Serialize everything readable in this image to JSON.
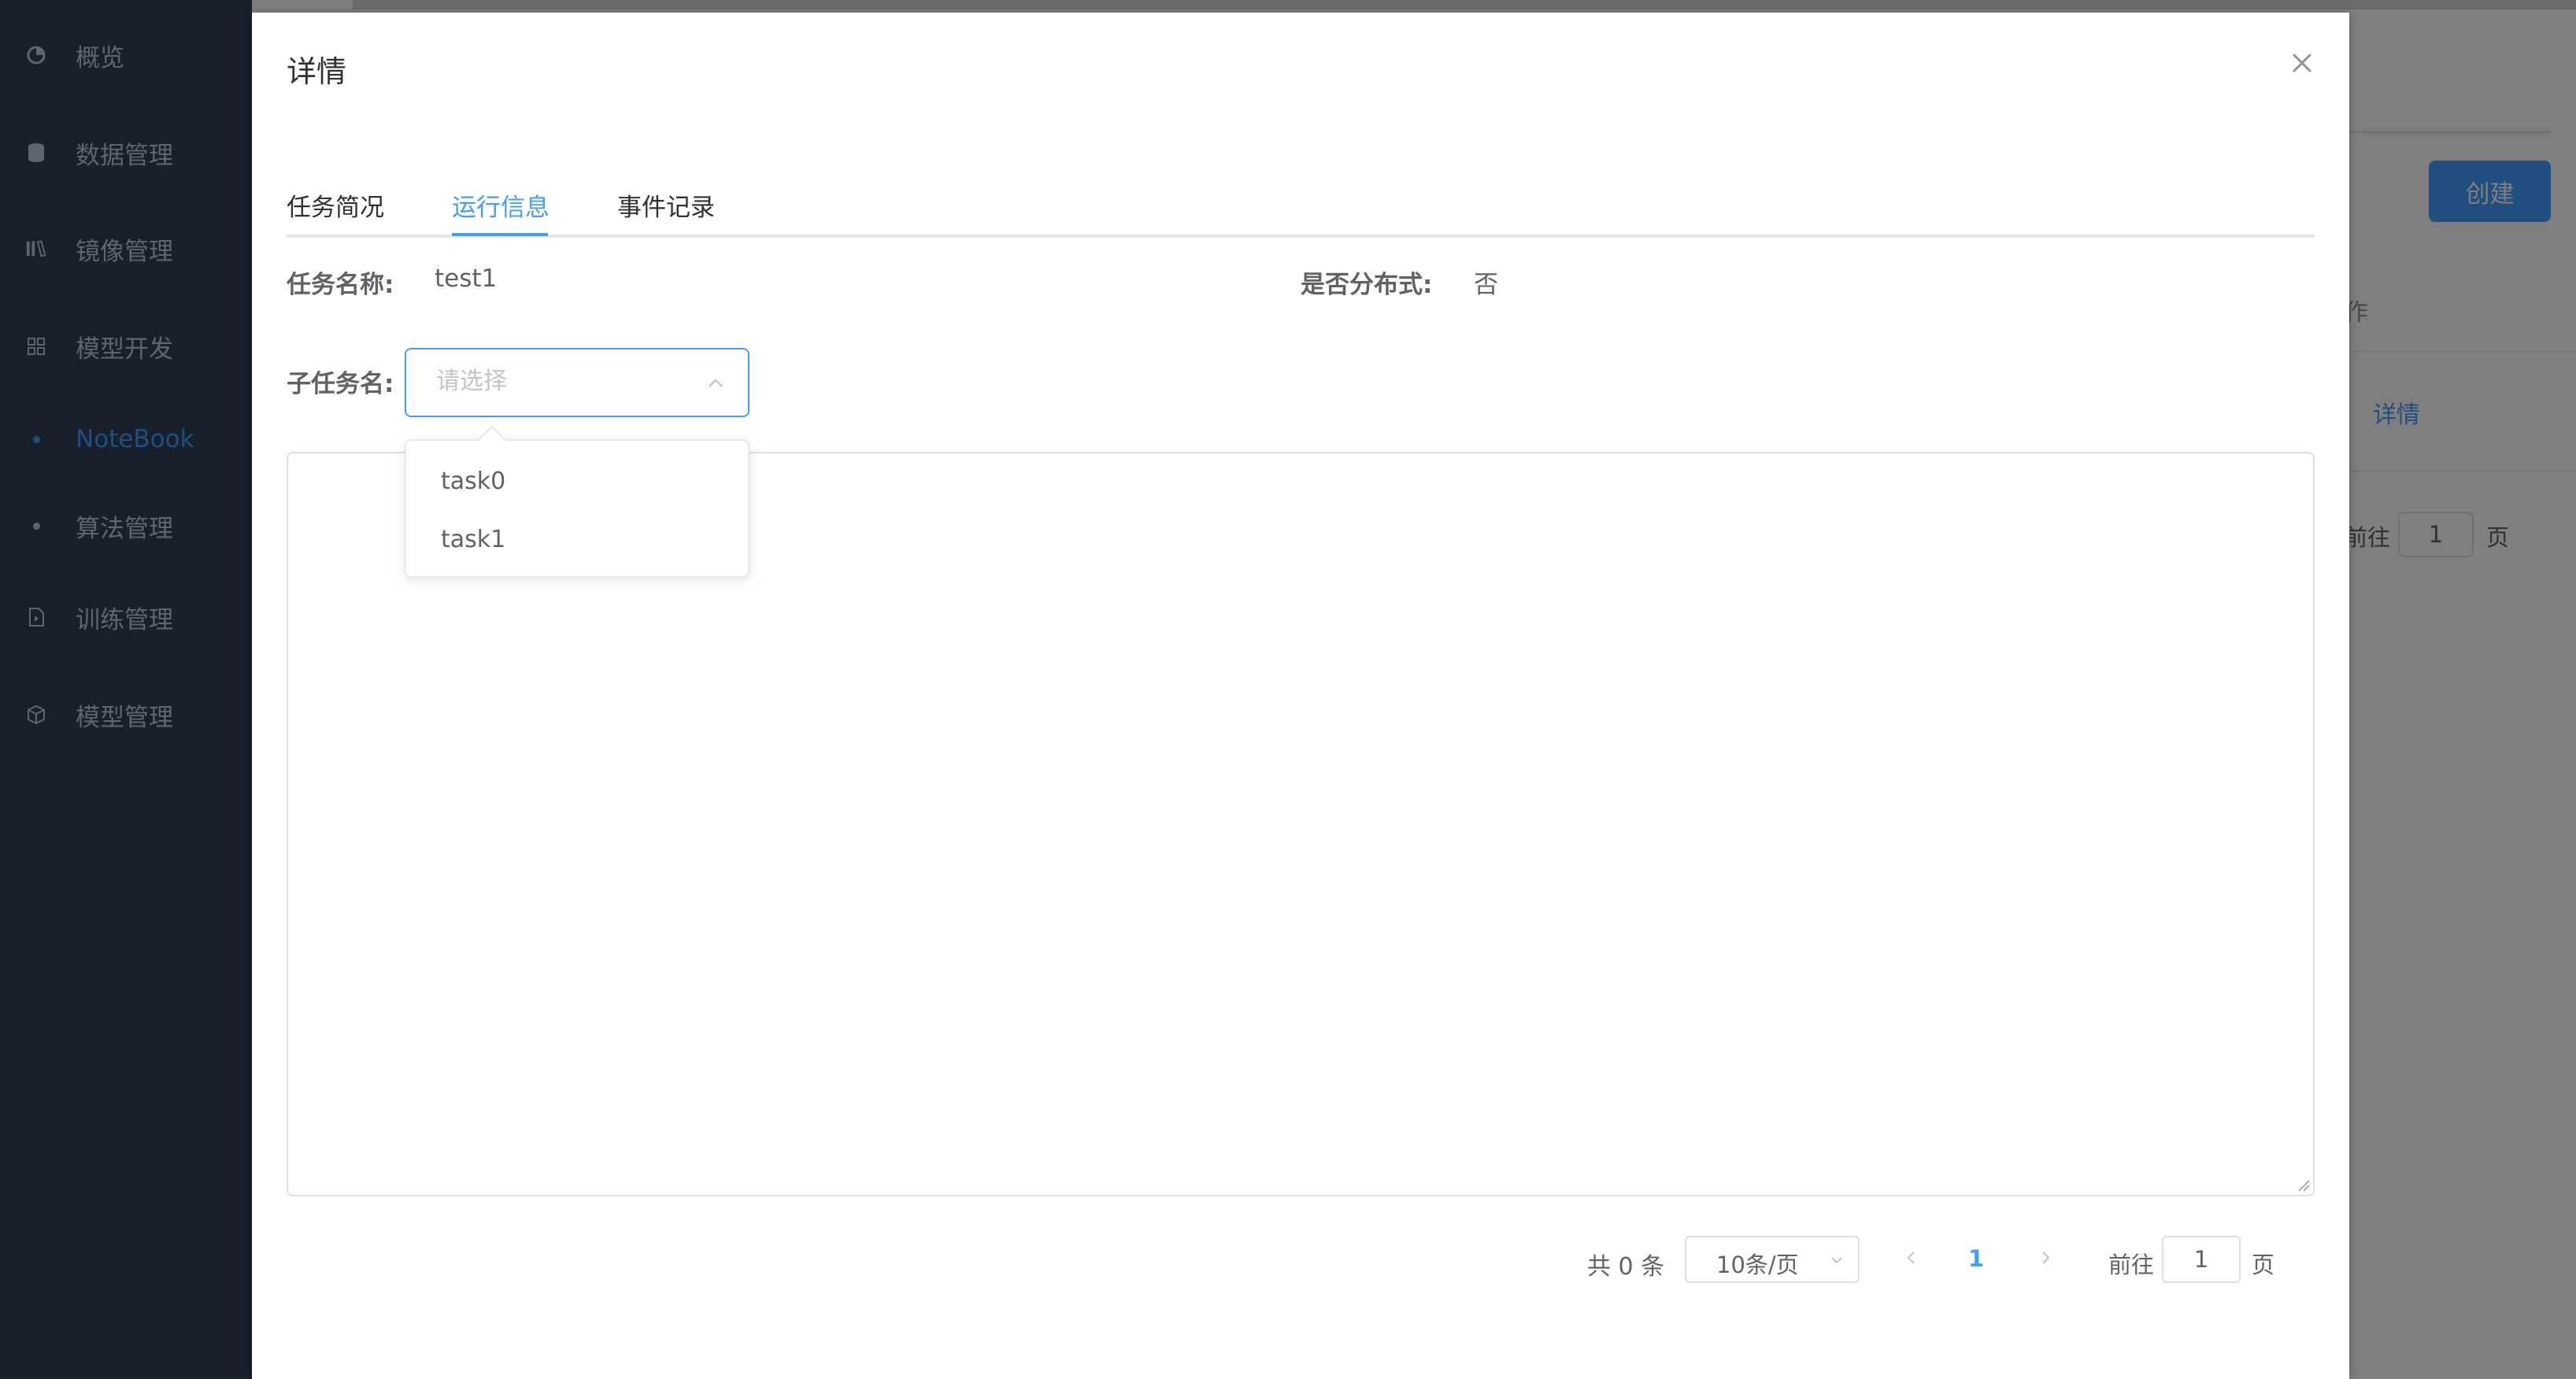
{
  "sidebar": {
    "items": [
      {
        "label": "概览",
        "icon": "pie-chart-icon"
      },
      {
        "label": "数据管理",
        "icon": "database-icon"
      },
      {
        "label": "镜像管理",
        "icon": "books-icon"
      },
      {
        "label": "模型开发",
        "icon": "grid-icon"
      },
      {
        "label": "NoteBook",
        "icon": "dot-icon",
        "active": true
      },
      {
        "label": "算法管理",
        "icon": "dot-icon"
      },
      {
        "label": "训练管理",
        "icon": "document-icon"
      },
      {
        "label": "模型管理",
        "icon": "cube-icon"
      }
    ]
  },
  "background": {
    "create_label": "创建",
    "column_header": "作",
    "detail_link": "详情",
    "goto_label": "前往",
    "goto_value": "1",
    "page_unit": "页"
  },
  "dialog": {
    "title": "详情",
    "tabs": [
      "任务简况",
      "运行信息",
      "事件记录"
    ],
    "active_tab": "运行信息",
    "task_name_label": "任务名称:",
    "task_name_value": "test1",
    "distributed_label": "是否分布式:",
    "distributed_value": "否",
    "subtask_label": "子任务名:",
    "subtask_placeholder": "请选择",
    "subtask_options": [
      "task0",
      "task1"
    ],
    "log_content": ""
  },
  "pagination": {
    "total_text": "共 0 条",
    "page_size": "10条/页",
    "current_page": "1",
    "goto_label": "前往",
    "goto_value": "1",
    "page_unit": "页"
  },
  "colors": {
    "accent": "#409eff",
    "sidebar_bg": "#304156",
    "overlay": "rgba(0,0,0,0.5)"
  }
}
